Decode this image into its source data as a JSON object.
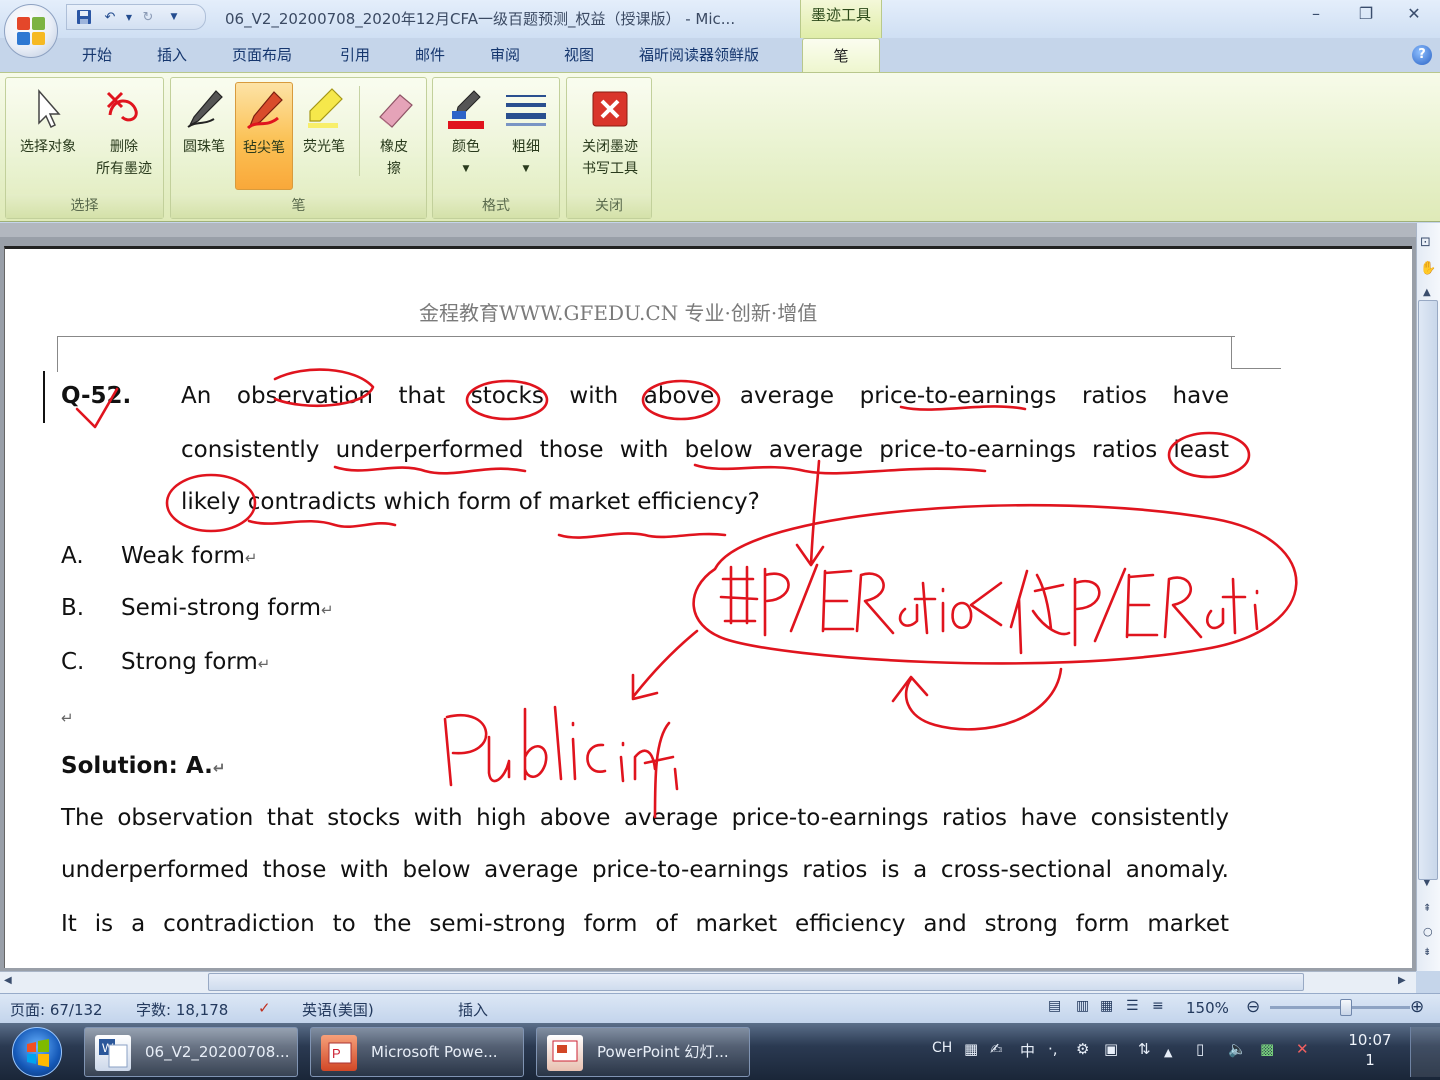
{
  "window": {
    "title": "06_V2_20200708_2020年12月CFA一级百题预测_权益（授课版） - Mic...",
    "context_tab_title": "墨迹工具",
    "controls": [
      "–",
      "❐",
      "✕"
    ]
  },
  "tabs": [
    "开始",
    "插入",
    "页面布局",
    "引用",
    "邮件",
    "审阅",
    "视图",
    "福昕阅读器领鲜版",
    "笔"
  ],
  "ribbon": {
    "groups": {
      "select": {
        "label": "选择",
        "select_objects": "选择对象",
        "delete_line1": "删除",
        "delete_line2": "所有墨迹"
      },
      "pens": {
        "label": "笔",
        "ballpoint": "圆珠笔",
        "felt_tip": "毡尖笔",
        "highlighter": "荧光笔",
        "eraser_line1": "橡皮",
        "eraser_line2": "擦"
      },
      "format": {
        "label": "格式",
        "color": "颜色",
        "weight": "粗细"
      },
      "close": {
        "label": "关闭",
        "close_line1": "关闭墨迹",
        "close_line2": "书写工具"
      }
    }
  },
  "document": {
    "header": "金程教育WWW.GFEDU.CN 专业·创新·增值",
    "question_id": "Q-52.",
    "question_lines": [
      "An observation that stocks with above average price-to-earnings ratios have",
      "consistently underperformed those with below average price-to-earnings ratios least",
      "likely contradicts which form of market efficiency?"
    ],
    "options": [
      {
        "letter": "A.",
        "text": "Weak form"
      },
      {
        "letter": "B.",
        "text": "Semi-strong form"
      },
      {
        "letter": "C.",
        "text": "Strong form"
      }
    ],
    "solution_label": "Solution: A.",
    "solution_lines": [
      "The observation that stocks with high above average price-to-earnings ratios have consistently",
      "underperformed those with below average price-to-earnings ratios is a cross-sectional anomaly.",
      "It is a contradiction to the semi-strong form of market efficiency and strong form market"
    ],
    "ink_annotations": [
      "高P/E Ratio < 低P/E Ratio",
      "Public info"
    ]
  },
  "statusbar": {
    "page": "页面: 67/132",
    "words": "字数: 18,178",
    "language": "英语(美国)",
    "mode": "插入",
    "zoom": "150%"
  },
  "taskbar": {
    "tasks": [
      "06_V2_20200708...",
      "Microsoft Powe...",
      "PowerPoint 幻灯..."
    ],
    "tray_lang": "CH",
    "tray_ime": "中",
    "time": "10:07",
    "date": "1"
  },
  "colors": {
    "ink": "#e0141e",
    "ribbon_accent": "#fbc154",
    "taskbar": "#1a2638"
  }
}
